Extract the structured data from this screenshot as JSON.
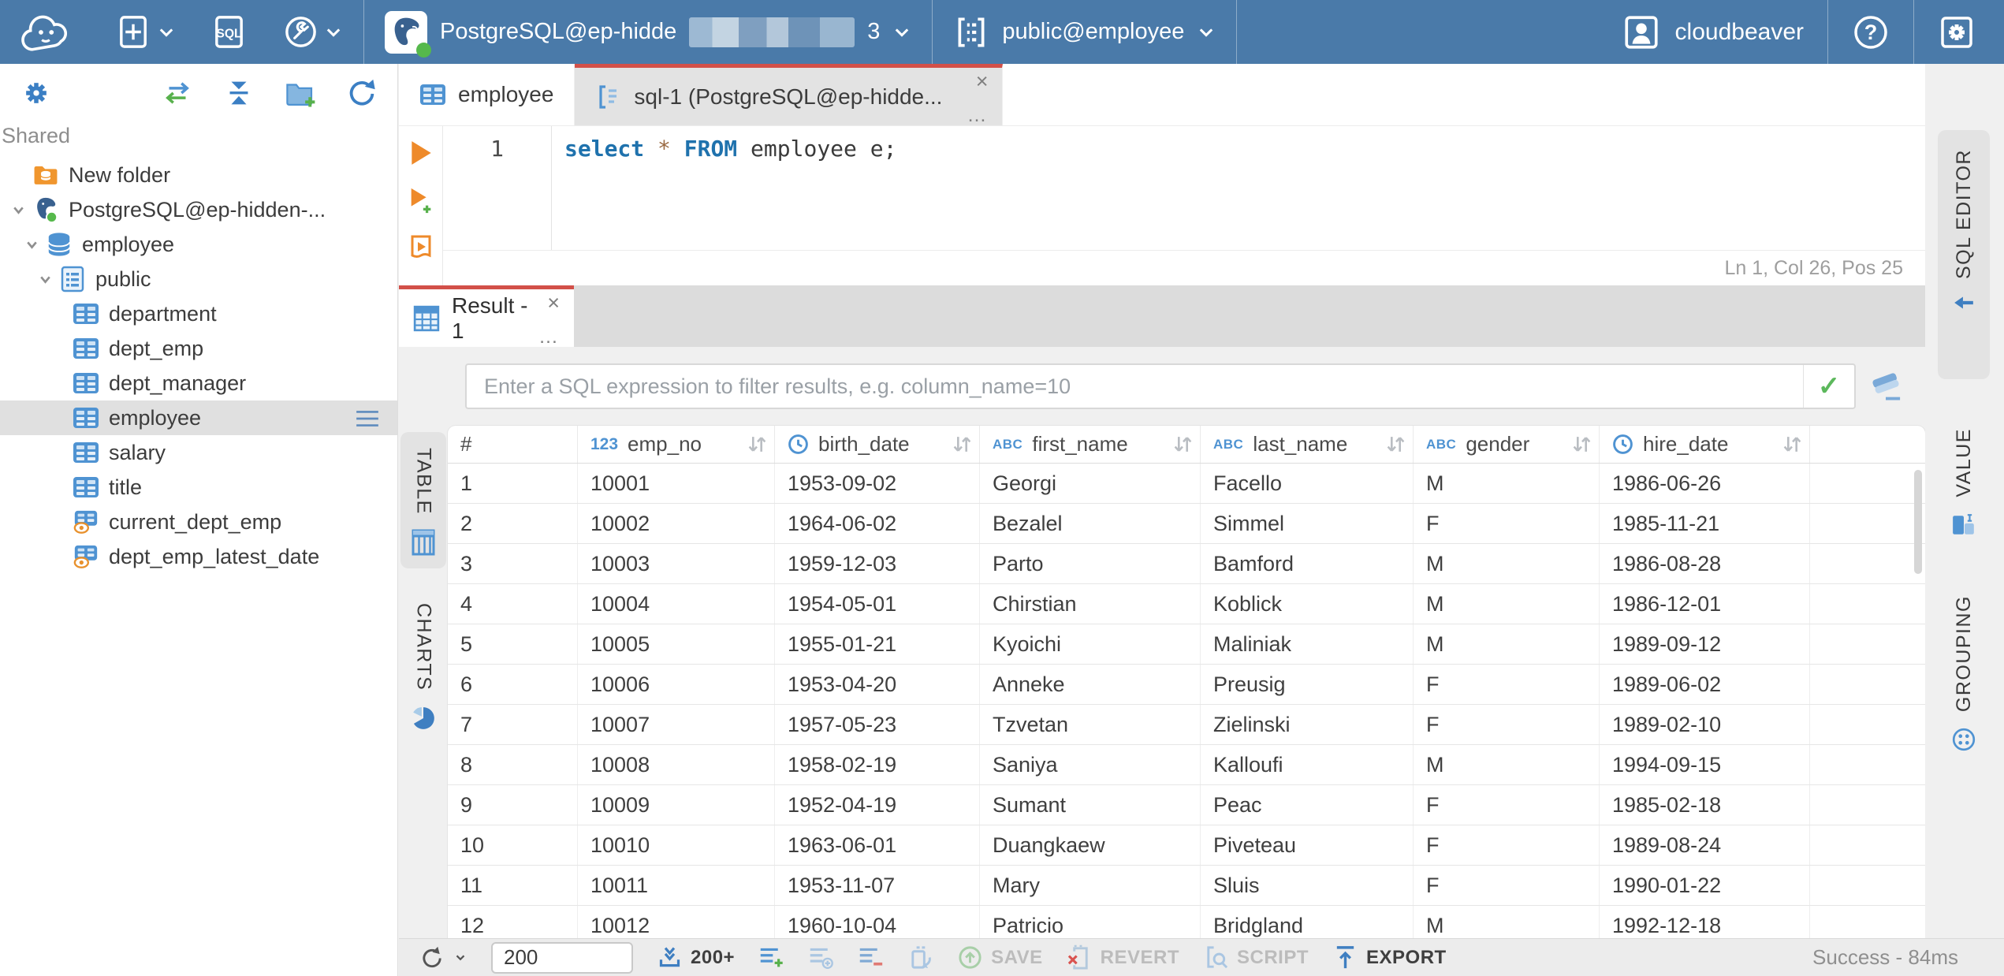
{
  "topbar": {
    "sql_badge": "SQL",
    "connection_label": "PostgreSQL@ep-hidde",
    "connection_suffix": "3",
    "schema_selector": "public@employee",
    "user_name": "cloudbeaver",
    "help_glyph": "?"
  },
  "glyphs": {
    "close": "×",
    "more": "…"
  },
  "sidebar": {
    "section_label": "Shared",
    "tree": [
      {
        "label": "New folder",
        "icon": "folder-db",
        "level": 0,
        "chevron": false,
        "selected": false
      },
      {
        "label": "PostgreSQL@ep-hidden-...",
        "icon": "postgres",
        "level": 0,
        "chevron": true,
        "selected": false
      },
      {
        "label": "employee",
        "icon": "database",
        "level": 1,
        "chevron": true,
        "selected": false
      },
      {
        "label": "public",
        "icon": "schema",
        "level": 2,
        "chevron": true,
        "selected": false
      },
      {
        "label": "department",
        "icon": "table",
        "level": 3,
        "chevron": false,
        "selected": false
      },
      {
        "label": "dept_emp",
        "icon": "table",
        "level": 3,
        "chevron": false,
        "selected": false
      },
      {
        "label": "dept_manager",
        "icon": "table",
        "level": 3,
        "chevron": false,
        "selected": false
      },
      {
        "label": "employee",
        "icon": "table",
        "level": 3,
        "chevron": false,
        "selected": true
      },
      {
        "label": "salary",
        "icon": "table",
        "level": 3,
        "chevron": false,
        "selected": false
      },
      {
        "label": "title",
        "icon": "table",
        "level": 3,
        "chevron": false,
        "selected": false
      },
      {
        "label": "current_dept_emp",
        "icon": "view",
        "level": 3,
        "chevron": false,
        "selected": false
      },
      {
        "label": "dept_emp_latest_date",
        "icon": "view",
        "level": 3,
        "chevron": false,
        "selected": false
      }
    ]
  },
  "editor": {
    "tabs": [
      {
        "label": "employee",
        "icon": "table",
        "active": false
      },
      {
        "label": "sql-1 (PostgreSQL@ep-hidde...",
        "icon": "sql-script",
        "active": true
      }
    ],
    "line_number": "1",
    "sql_tokens": [
      {
        "text": "select",
        "type": "keyword"
      },
      {
        "text": " ",
        "type": "plain"
      },
      {
        "text": "*",
        "type": "star"
      },
      {
        "text": " ",
        "type": "plain"
      },
      {
        "text": "FROM",
        "type": "keyword"
      },
      {
        "text": " employee e;",
        "type": "plain"
      }
    ],
    "status": "Ln 1, Col 26, Pos 25",
    "panel_tab": "SQL EDITOR"
  },
  "results": {
    "tab_label": "Result - 1",
    "filter_placeholder": "Enter a SQL expression to filter results, e.g. column_name=10",
    "left_tabs": [
      {
        "label": "TABLE",
        "icon": "grid",
        "selected": true
      },
      {
        "label": "CHARTS",
        "icon": "pie",
        "selected": false
      }
    ],
    "right_tabs": [
      {
        "label": "VALUE",
        "icon": "value-panel"
      },
      {
        "label": "GROUPING",
        "icon": "grouping"
      }
    ],
    "grid": {
      "row_header": "#",
      "columns": [
        {
          "name": "emp_no",
          "type": "number",
          "badge": "123"
        },
        {
          "name": "birth_date",
          "type": "date",
          "badge": "clock"
        },
        {
          "name": "first_name",
          "type": "string",
          "badge": "ABC"
        },
        {
          "name": "last_name",
          "type": "string",
          "badge": "ABC"
        },
        {
          "name": "gender",
          "type": "string",
          "badge": "ABC"
        },
        {
          "name": "hire_date",
          "type": "date",
          "badge": "clock"
        }
      ],
      "rows": [
        {
          "num": "1",
          "emp_no": "10001",
          "birth_date": "1953-09-02",
          "first_name": "Georgi",
          "last_name": "Facello",
          "gender": "M",
          "hire_date": "1986-06-26"
        },
        {
          "num": "2",
          "emp_no": "10002",
          "birth_date": "1964-06-02",
          "first_name": "Bezalel",
          "last_name": "Simmel",
          "gender": "F",
          "hire_date": "1985-11-21"
        },
        {
          "num": "3",
          "emp_no": "10003",
          "birth_date": "1959-12-03",
          "first_name": "Parto",
          "last_name": "Bamford",
          "gender": "M",
          "hire_date": "1986-08-28"
        },
        {
          "num": "4",
          "emp_no": "10004",
          "birth_date": "1954-05-01",
          "first_name": "Chirstian",
          "last_name": "Koblick",
          "gender": "M",
          "hire_date": "1986-12-01"
        },
        {
          "num": "5",
          "emp_no": "10005",
          "birth_date": "1955-01-21",
          "first_name": "Kyoichi",
          "last_name": "Maliniak",
          "gender": "M",
          "hire_date": "1989-09-12"
        },
        {
          "num": "6",
          "emp_no": "10006",
          "birth_date": "1953-04-20",
          "first_name": "Anneke",
          "last_name": "Preusig",
          "gender": "F",
          "hire_date": "1989-06-02"
        },
        {
          "num": "7",
          "emp_no": "10007",
          "birth_date": "1957-05-23",
          "first_name": "Tzvetan",
          "last_name": "Zielinski",
          "gender": "F",
          "hire_date": "1989-02-10"
        },
        {
          "num": "8",
          "emp_no": "10008",
          "birth_date": "1958-02-19",
          "first_name": "Saniya",
          "last_name": "Kalloufi",
          "gender": "M",
          "hire_date": "1994-09-15"
        },
        {
          "num": "9",
          "emp_no": "10009",
          "birth_date": "1952-04-19",
          "first_name": "Sumant",
          "last_name": "Peac",
          "gender": "F",
          "hire_date": "1985-02-18"
        },
        {
          "num": "10",
          "emp_no": "10010",
          "birth_date": "1963-06-01",
          "first_name": "Duangkaew",
          "last_name": "Piveteau",
          "gender": "F",
          "hire_date": "1989-08-24"
        },
        {
          "num": "11",
          "emp_no": "10011",
          "birth_date": "1953-11-07",
          "first_name": "Mary",
          "last_name": "Sluis",
          "gender": "F",
          "hire_date": "1990-01-22"
        },
        {
          "num": "12",
          "emp_no": "10012",
          "birth_date": "1960-10-04",
          "first_name": "Patricio",
          "last_name": "Bridgland",
          "gender": "M",
          "hire_date": "1992-12-18"
        }
      ]
    }
  },
  "statusbar": {
    "row_limit": "200",
    "fetch_size_label": "200+",
    "save_label": "SAVE",
    "revert_label": "REVERT",
    "script_label": "SCRIPT",
    "export_label": "EXPORT",
    "result_status": "Success - 84ms"
  },
  "colors": {
    "topbar_blue": "#4a7aa9",
    "accent_red": "#d25049",
    "icon_blue": "#4f93d2",
    "orange": "#ee8a2a",
    "green": "#58b14c"
  }
}
